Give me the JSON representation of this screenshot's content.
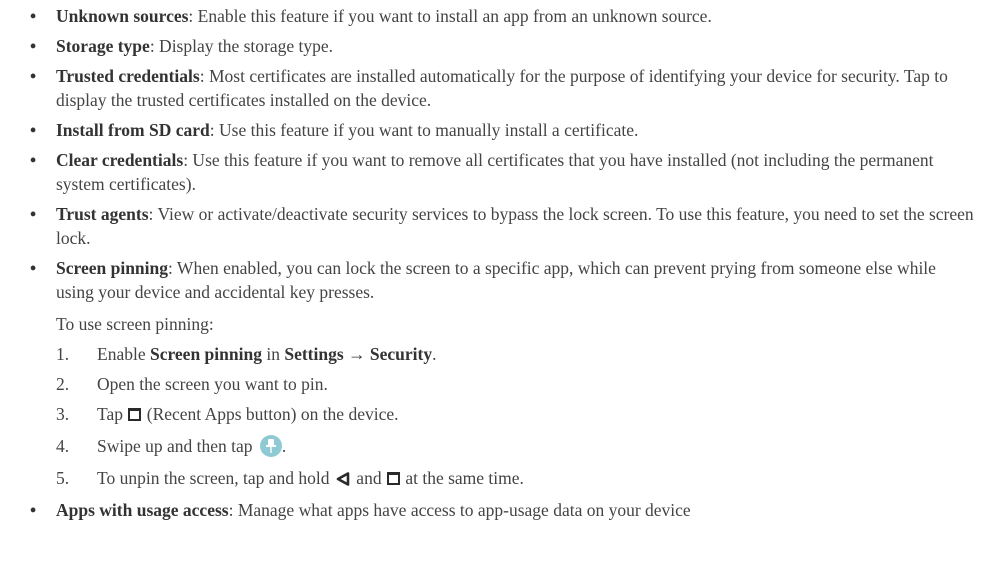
{
  "bullet_symbol": "•",
  "items": [
    {
      "term": "Unknown sources",
      "desc": ": Enable this feature if you want to install an app from an unknown source."
    },
    {
      "term": "Storage type",
      "desc": ": Display the storage type."
    },
    {
      "term": "Trusted credentials",
      "desc": ": Most certificates are installed automatically for the purpose of identifying your device for security. Tap to display the trusted certificates installed on the device."
    },
    {
      "term": "Install from SD card",
      "desc": ": Use this feature if you want to manually install a certificate."
    },
    {
      "term": "Clear credentials",
      "desc": ": Use this feature if you want to remove all certificates that you have installed (not including the permanent system certificates)."
    },
    {
      "term": "Trust agents",
      "desc": ": View or activate/deactivate security services to bypass the lock screen. To use this feature, you need to set the screen lock."
    },
    {
      "term": "Screen pinning",
      "desc": ": When enabled, you can lock the screen to a specific app, which can prevent prying from someone else while using your device and accidental key presses."
    },
    {
      "term": "Apps with usage access",
      "desc": ": Manage what apps have access to app-usage data on your device"
    }
  ],
  "pinning_intro": "To use screen pinning:",
  "steps": {
    "s1": {
      "num": "1.",
      "a": "Enable ",
      "b": "Screen pinning",
      "c": " in ",
      "d": "Settings",
      "arrow": "→",
      "e": "Security",
      "f": "."
    },
    "s2": {
      "num": "2.",
      "text": "Open the screen you want to pin."
    },
    "s3": {
      "num": "3.",
      "a": "Tap ",
      "b": " (Recent Apps button) on the device."
    },
    "s4": {
      "num": "4.",
      "a": "Swipe up and then tap ",
      "b": "."
    },
    "s5": {
      "num": "5.",
      "a": "To unpin the screen, tap and hold ",
      "b": " and ",
      "c": " at the same time."
    }
  },
  "icons": {
    "recent_apps": "recent-apps-icon",
    "back": "back-triangle-icon",
    "pin": "pin-icon",
    "pin_badge_color": "#8fc9d3"
  }
}
